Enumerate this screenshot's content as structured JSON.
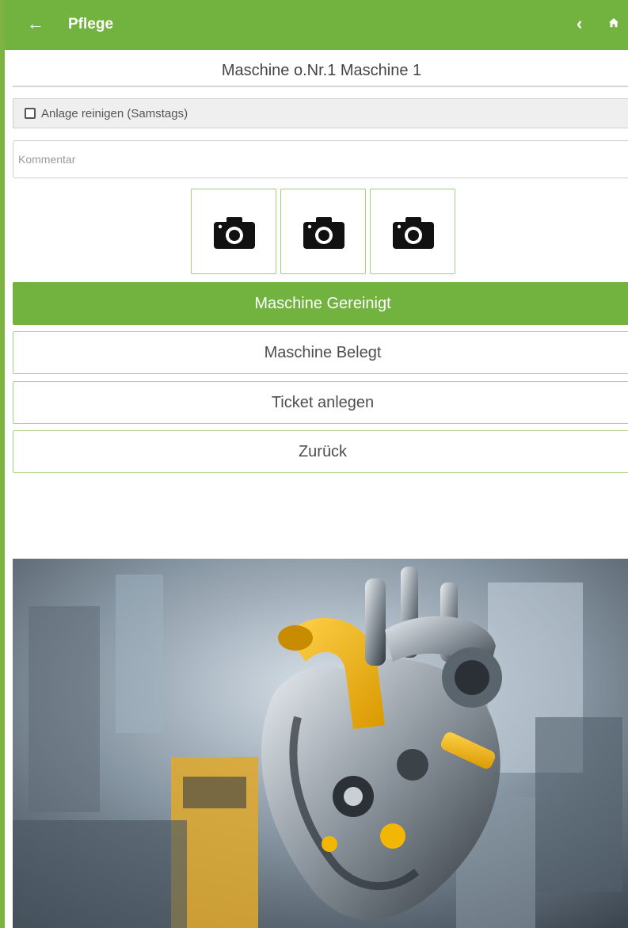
{
  "header": {
    "back_icon": "arrow-left-icon",
    "title": "Pflege",
    "prev_icon": "chevron-left-icon",
    "home_icon": "home-icon",
    "color": "#72b23f"
  },
  "machine": {
    "title": "Maschine o.Nr.1 Maschine 1"
  },
  "checklist": {
    "label": "Anlage reinigen (Samstags)",
    "checked": false
  },
  "comment": {
    "placeholder": "Kommentar",
    "value": ""
  },
  "photos": [
    {
      "icon": "camera-icon"
    },
    {
      "icon": "camera-icon"
    },
    {
      "icon": "camera-icon"
    }
  ],
  "actions": {
    "cleaned": "Maschine Gereinigt",
    "occupied": "Maschine Belegt",
    "ticket": "Ticket anlegen",
    "back": "Zurück"
  },
  "colors": {
    "accent": "#72b23f",
    "border": "#a5d07c",
    "hero_yellow": "#f2b705"
  }
}
